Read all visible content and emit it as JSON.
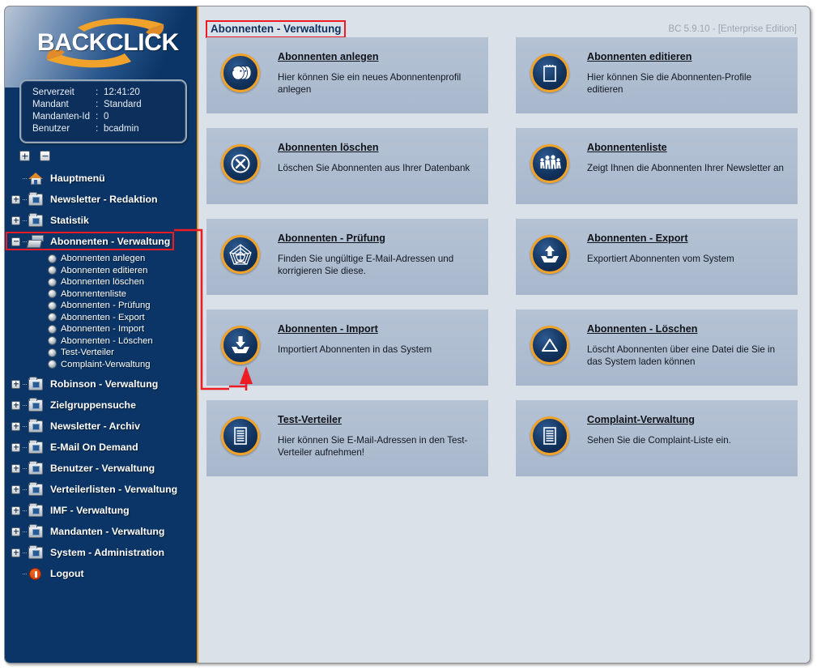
{
  "window": {
    "version_label": "BC 5.9.10 - [Enterprise Edition]",
    "page_title": "Abonnenten - Verwaltung"
  },
  "brand": {
    "logo_text": "BACKCLICK",
    "accent": "#f0a22a",
    "navy": "#0b3566"
  },
  "server_info": [
    {
      "key": "Serverzeit",
      "sep": ":",
      "value": "12:41:20"
    },
    {
      "key": "Mandant",
      "sep": ":",
      "value": "Standard"
    },
    {
      "key": "Mandanten-Id",
      "sep": ":",
      "value": "0"
    },
    {
      "key": "Benutzer",
      "sep": ":",
      "value": "bcadmin"
    }
  ],
  "tree_controls": {
    "expand_all": "+",
    "collapse_all": "-"
  },
  "sidebar": {
    "items": [
      {
        "label": "Hauptmenü",
        "icon": "house-icon",
        "twisty": "none"
      },
      {
        "label": "Newsletter - Redaktion",
        "icon": "folder-icon",
        "twisty": "plus"
      },
      {
        "label": "Statistik",
        "icon": "folder-icon",
        "twisty": "plus"
      },
      {
        "label": "Abonnenten - Verwaltung",
        "icon": "folder-open-icon",
        "twisty": "minus",
        "active": true
      },
      {
        "label": "Robinson - Verwaltung",
        "icon": "folder-icon",
        "twisty": "plus"
      },
      {
        "label": "Zielgruppensuche",
        "icon": "folder-icon",
        "twisty": "plus"
      },
      {
        "label": "Newsletter - Archiv",
        "icon": "folder-icon",
        "twisty": "plus"
      },
      {
        "label": "E-Mail On Demand",
        "icon": "folder-icon",
        "twisty": "plus"
      },
      {
        "label": "Benutzer - Verwaltung",
        "icon": "folder-icon",
        "twisty": "plus"
      },
      {
        "label": "Verteilerlisten - Verwaltung",
        "icon": "folder-icon",
        "twisty": "plus"
      },
      {
        "label": "IMF - Verwaltung",
        "icon": "folder-icon",
        "twisty": "plus"
      },
      {
        "label": "Mandanten - Verwaltung",
        "icon": "folder-icon",
        "twisty": "plus"
      },
      {
        "label": "System - Administration",
        "icon": "folder-icon",
        "twisty": "plus"
      },
      {
        "label": "Logout",
        "icon": "logout-icon",
        "twisty": "none"
      }
    ],
    "subitems": [
      "Abonnenten anlegen",
      "Abonnenten editieren",
      "Abonnenten löschen",
      "Abonnentenliste",
      "Abonnenten - Prüfung",
      "Abonnenten - Export",
      "Abonnenten - Import",
      "Abonnenten - Löschen",
      "Test-Verteiler",
      "Complaint-Verwaltung"
    ]
  },
  "cards": [
    {
      "title": "Abonnenten anlegen",
      "desc": "Hier können Sie ein neues Abonnentenprofil anlegen",
      "icon": "two-faces-icon"
    },
    {
      "title": "Abonnenten editieren",
      "desc": "Hier können Sie die Abonnenten-Profile editieren",
      "icon": "notepad-icon"
    },
    {
      "title": "Abonnenten löschen",
      "desc": "Löschen Sie Abonnenten aus Ihrer Datenbank",
      "icon": "x-circle-icon"
    },
    {
      "title": "Abonnentenliste",
      "desc": "Zeigt Ihnen die Abonnenten Ihrer Newsletter an",
      "icon": "people-group-icon"
    },
    {
      "title": "Abonnenten - Prüfung",
      "desc": "Finden Sie ungültige E-Mail-Adressen und korrigieren Sie diese.",
      "icon": "spider-web-icon"
    },
    {
      "title": "Abonnenten - Export",
      "desc": "Exportiert Abonnenten vom System",
      "icon": "upload-tray-icon"
    },
    {
      "title": "Abonnenten - Import",
      "desc": "Importiert Abonnenten in das System",
      "icon": "download-tray-icon"
    },
    {
      "title": "Abonnenten - Löschen",
      "desc": "Löscht Abonnenten über eine Datei die Sie in das System laden können",
      "icon": "triangle-icon"
    },
    {
      "title": "Test-Verteiler",
      "desc": "Hier können Sie E-Mail-Adressen in den Test-Verteiler aufnehmen!",
      "icon": "document-lines-icon"
    },
    {
      "title": "Complaint-Verwaltung",
      "desc": "Sehen Sie die Complaint-Liste ein.",
      "icon": "document-lines-icon"
    }
  ],
  "annotation": {
    "color": "#ed1c24",
    "description": "red callout linking sidebar entry to Abonnenten - Import card"
  }
}
